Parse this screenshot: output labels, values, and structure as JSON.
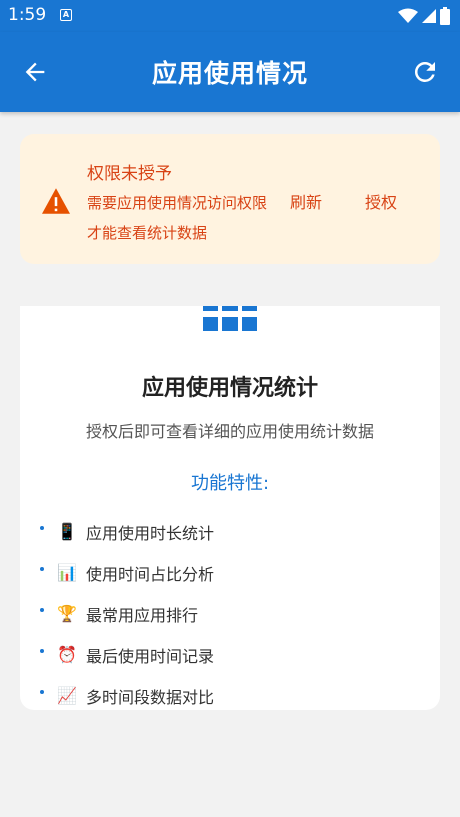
{
  "status_bar": {
    "time": "1:59",
    "notif_letter": "A"
  },
  "app_bar": {
    "title": "应用使用情况"
  },
  "warning": {
    "title": "权限未授予",
    "message": "需要应用使用情况访问权限才能查看统计数据",
    "refresh_label": "刷新",
    "grant_label": "授权"
  },
  "info": {
    "title": "应用使用情况统计",
    "subtitle": "授权后即可查看详细的应用使用统计数据",
    "features_title": "功能特性:",
    "features": [
      {
        "icon": "📱",
        "label": "应用使用时长统计"
      },
      {
        "icon": "📊",
        "label": "使用时间占比分析"
      },
      {
        "icon": "🏆",
        "label": "最常用应用排行"
      },
      {
        "icon": "⏰",
        "label": "最后使用时间记录"
      },
      {
        "icon": "📈",
        "label": "多时间段数据对比"
      }
    ]
  },
  "colors": {
    "primary": "#1976d2",
    "warning_bg": "#fff3e0",
    "warning_text": "#d84315",
    "warning_icon": "#e65100"
  }
}
